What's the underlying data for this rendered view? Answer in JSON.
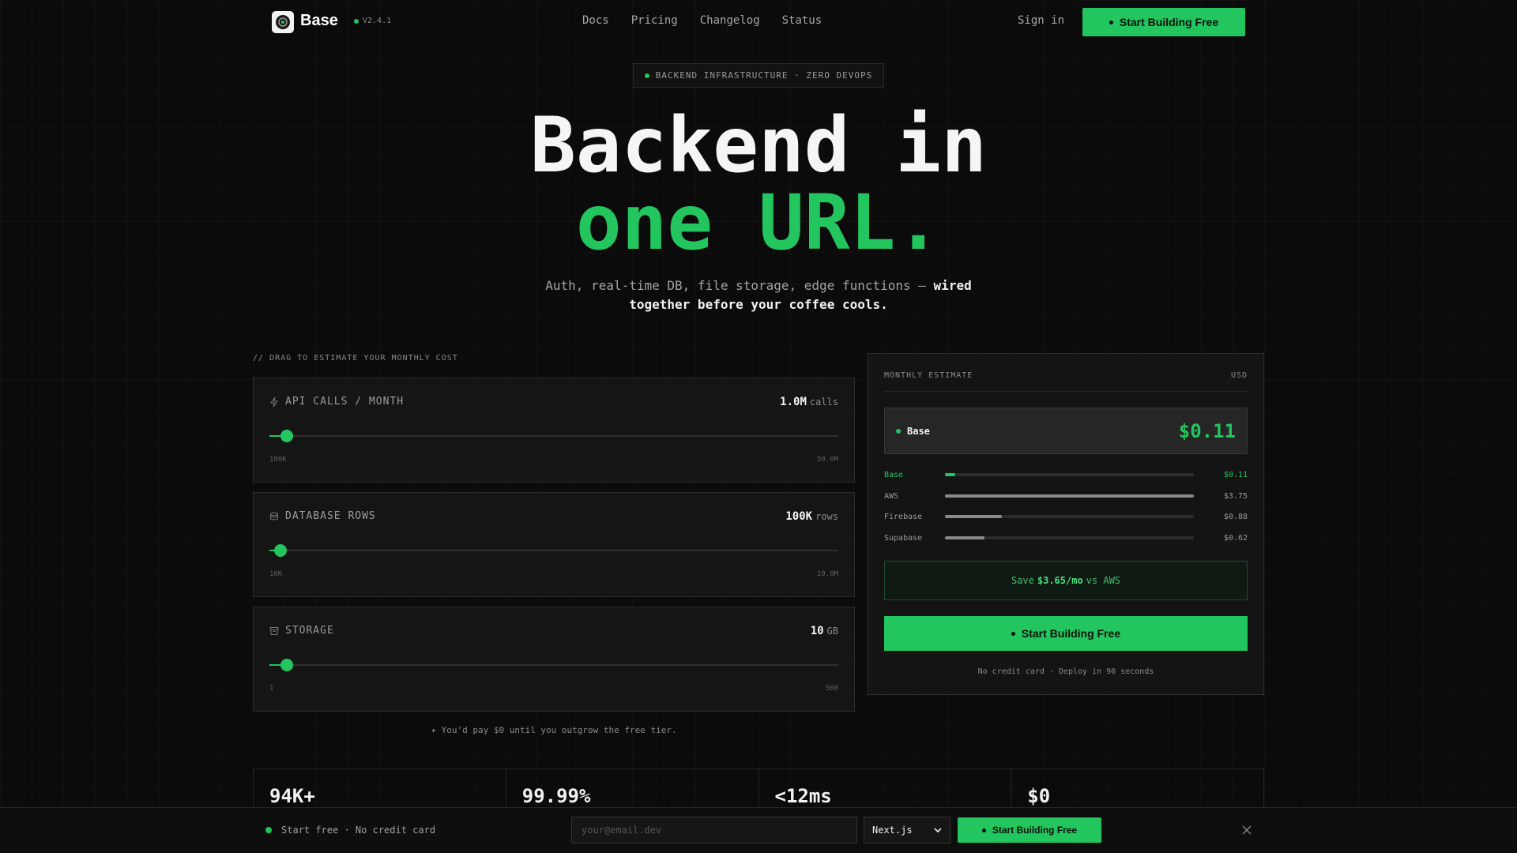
{
  "nav": {
    "brand": "Base",
    "version": "V2.4.1",
    "links": [
      "Docs",
      "Pricing",
      "Changelog",
      "Status"
    ],
    "signin": "Sign in",
    "cta": "Start Building Free"
  },
  "hero": {
    "pill": "BACKEND INFRASTRUCTURE · ZERO DEVOPS",
    "line1": "Backend in",
    "line2": "one URL.",
    "sub_plain": "Auth, real-time DB, file storage, edge functions — ",
    "sub_bold1": "wired",
    "sub_bold2": "together before your coffee cools."
  },
  "estimator": {
    "hint": "// DRAG TO ESTIMATE YOUR MONTHLY COST",
    "sliders": [
      {
        "label": "API CALLS / MONTH",
        "value": "1.0M",
        "unit": "calls",
        "min": "100K",
        "max": "50.0M",
        "level": 0.03,
        "icon": "bolt-icon"
      },
      {
        "label": "DATABASE ROWS",
        "value": "100K",
        "unit": "rows",
        "min": "10K",
        "max": "10.0M",
        "level": 0.02,
        "icon": "database-icon"
      },
      {
        "label": "STORAGE",
        "value": "10",
        "unit": "GB",
        "min": "1",
        "max": "500",
        "level": 0.03,
        "icon": "archive-icon"
      }
    ],
    "note": "✦ You'd pay $0 until you outgrow the free tier."
  },
  "panel": {
    "title": "MONTHLY ESTIMATE",
    "currency": "USD",
    "base_name": "Base",
    "base_price": "$0.11",
    "compare": [
      {
        "name": "Base",
        "price": "$0.11",
        "level": 0.04,
        "color": "#22c55e"
      },
      {
        "name": "AWS",
        "price": "$3.75",
        "level": 1.0,
        "color": "#8a8a8a"
      },
      {
        "name": "Firebase",
        "price": "$0.88",
        "level": 0.23,
        "color": "#8a8a8a"
      },
      {
        "name": "Supabase",
        "price": "$0.62",
        "level": 0.16,
        "color": "#8a8a8a"
      }
    ],
    "save_prefix": "Save",
    "save_amount": "$3.65/mo",
    "save_suffix": "vs AWS",
    "cta": "Start Building Free",
    "note": "No credit card · Deploy in 90 seconds"
  },
  "stats": [
    "94K+",
    "99.99%",
    "<12ms",
    "$0"
  ],
  "bottom_bar": {
    "text": "Start free · No credit card",
    "email_placeholder": "your@email.dev",
    "framework": "Next.js",
    "cta": "Start Building Free"
  },
  "colors": {
    "accent": "#22c55e",
    "background": "#0b0b0b"
  }
}
